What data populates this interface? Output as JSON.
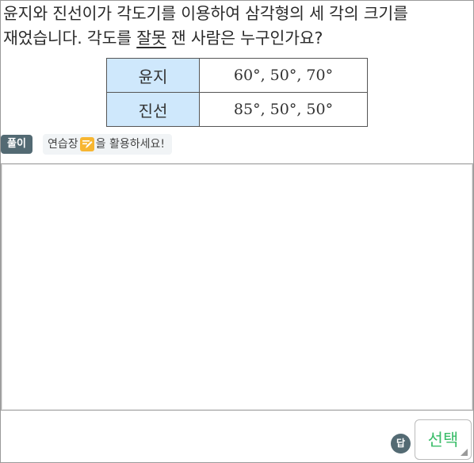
{
  "question": {
    "line1": "윤지와 진선이가 각도기를 이용하여 삼각형의 세 각의 크기를",
    "line2_before": "재었습니다. 각도를 ",
    "line2_underlined": "잘못",
    "line2_after": " 잰 사람은 누구인가요?"
  },
  "table": {
    "rows": [
      {
        "name": "윤지",
        "value": "60°, 50°, 70°"
      },
      {
        "name": "진선",
        "value": "85°, 50°, 50°"
      }
    ]
  },
  "solution_badge": "풀이",
  "hint": {
    "before": "연습장",
    "icon": "memo-pencil-icon",
    "after": "을 활용하세요!"
  },
  "answer": {
    "badge": "답",
    "select_label": "선택"
  },
  "colors": {
    "table_header_bg": "#cfe8fc",
    "badge_bg": "#536a73",
    "select_text": "#3bbd6a",
    "memo_icon": "#f7b632"
  }
}
